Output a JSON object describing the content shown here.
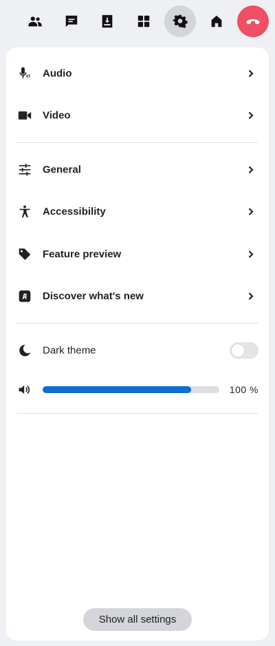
{
  "toolbar": {
    "buttons": [
      {
        "icon": "people-icon"
      },
      {
        "icon": "chat-icon"
      },
      {
        "icon": "share-tray-icon"
      },
      {
        "icon": "apps-icon"
      },
      {
        "icon": "settings-gear-icon",
        "active": true
      },
      {
        "icon": "home-icon"
      },
      {
        "icon": "hang-up-icon",
        "color": "#ee4f65"
      }
    ]
  },
  "settings": {
    "audio_label": "Audio",
    "video_label": "Video",
    "general_label": "General",
    "accessibility_label": "Accessibility",
    "feature_preview_label": "Feature preview",
    "discover_label": "Discover what's new",
    "dark_theme_label": "Dark theme",
    "dark_theme_on": false,
    "volume_value": "100",
    "volume_unit": "%",
    "volume_fill_fraction": 0.84
  },
  "show_all_label": "Show all settings",
  "colors": {
    "accent": "#0e6fcc",
    "hangup": "#ee4f65",
    "panel": "#ffffff",
    "background": "#eef0f3"
  }
}
